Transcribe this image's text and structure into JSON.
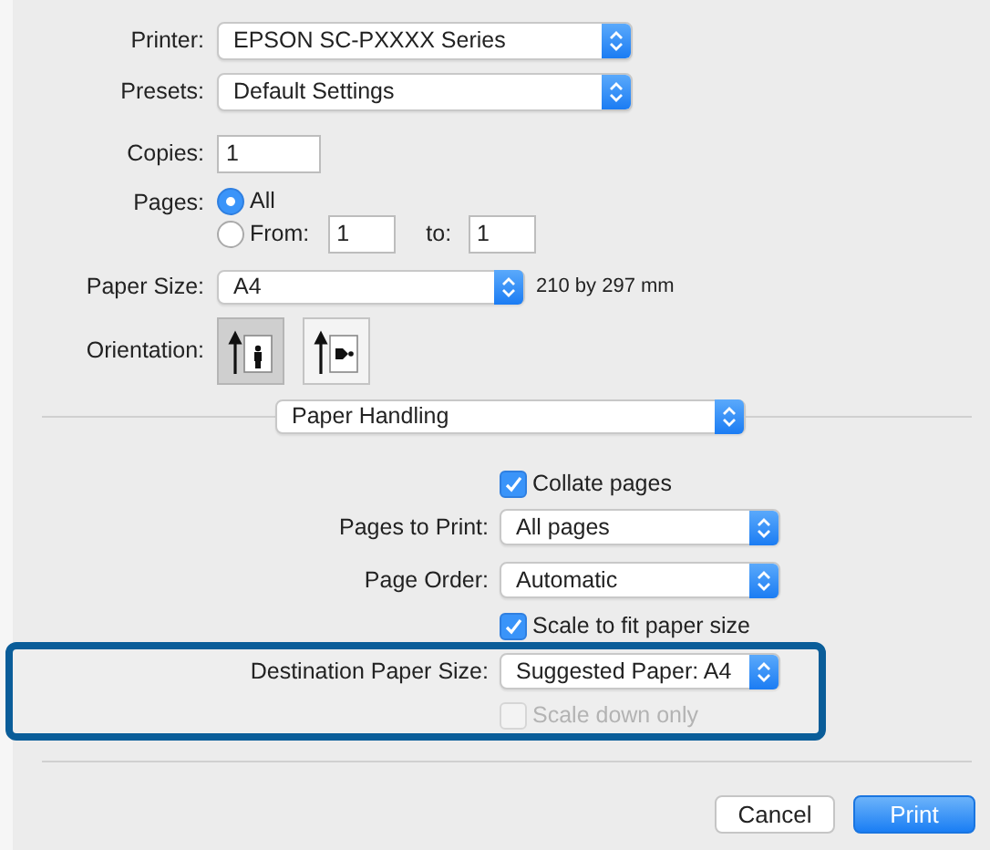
{
  "print_settings": {
    "printer": {
      "label": "Printer:",
      "value": "EPSON SC-PXXXX Series"
    },
    "presets": {
      "label": "Presets:",
      "value": "Default Settings"
    },
    "copies": {
      "label": "Copies:",
      "value": "1"
    },
    "pages": {
      "label": "Pages:",
      "options": [
        {
          "label": "All",
          "selected": true
        },
        {
          "label": "From:",
          "selected": false
        }
      ],
      "from": "1",
      "to_label": "to:",
      "to": "1"
    },
    "paper_size": {
      "label": "Paper Size:",
      "value": "A4",
      "dimensions": "210 by 297 mm"
    },
    "orientation": {
      "label": "Orientation:",
      "options": [
        {
          "kind": "portrait",
          "selected": true
        },
        {
          "kind": "landscape",
          "selected": false
        }
      ]
    }
  },
  "section_menu": {
    "value": "Paper Handling"
  },
  "paper_handling": {
    "items": [
      {
        "kind": "checkbox",
        "label": "Collate pages",
        "checked": true,
        "disabled": false,
        "highlighted": false
      },
      {
        "kind": "select",
        "label": "Pages to Print:",
        "value": "All pages",
        "highlighted": false
      },
      {
        "kind": "select",
        "label": "Page Order:",
        "value": "Automatic",
        "highlighted": false
      },
      {
        "kind": "checkbox",
        "label": "Scale to fit paper size",
        "checked": true,
        "disabled": false,
        "highlighted": false
      },
      {
        "kind": "select",
        "label": "Destination Paper Size:",
        "value": "Suggested Paper: A4",
        "highlighted": true
      },
      {
        "kind": "checkbox",
        "label": "Scale down only",
        "checked": false,
        "disabled": true,
        "highlighted": true
      }
    ]
  },
  "buttons": [
    {
      "label": "Cancel",
      "kind": "secondary"
    },
    {
      "label": "Print",
      "kind": "primary"
    }
  ]
}
